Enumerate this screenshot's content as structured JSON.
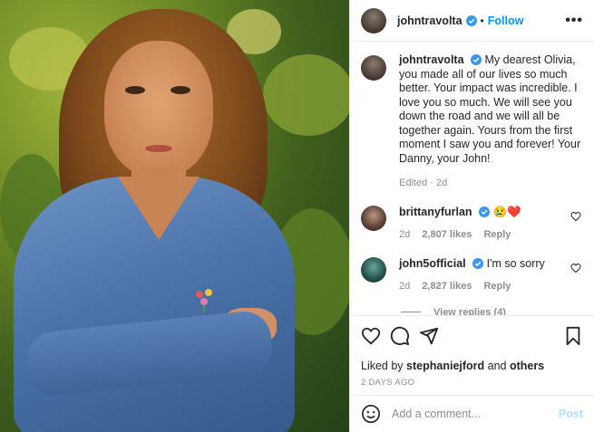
{
  "post": {
    "username": "johntravolta",
    "follow_label": "Follow",
    "more_label": "•••",
    "separator": "•"
  },
  "caption": {
    "username": "johntravolta",
    "text": "My dearest Olivia, you made all of our lives so much better. Your impact was incredible. I love you so much. We will see you down the road and we will all be together again. Yours from the first moment I saw you and forever! Your Danny, your John!",
    "edited_label": "Edited · 2d"
  },
  "comments": [
    {
      "username": "brittanyfurlan",
      "text": "😢❤️",
      "age": "2d",
      "likes": "2,807 likes",
      "reply_label": "Reply"
    },
    {
      "username": "john5official",
      "text": "I'm so sorry",
      "age": "2d",
      "likes": "2,827 likes",
      "reply_label": "Reply"
    }
  ],
  "view_replies": "View replies (4)",
  "likes": {
    "prefix": "Liked by",
    "user": "stephaniejford",
    "connector": "and",
    "others": "others"
  },
  "date": "2 DAYS AGO",
  "add_comment": {
    "placeholder": "Add a comment...",
    "post_label": "Post"
  },
  "colors": {
    "accent": "#0095f6",
    "post_disabled": "#b2dffc",
    "muted": "#8e8e8e",
    "verified": "#3897f0"
  },
  "icons": [
    "verified-icon",
    "more-icon",
    "heart-icon",
    "comment-icon",
    "share-icon",
    "bookmark-icon",
    "emoji-icon"
  ]
}
